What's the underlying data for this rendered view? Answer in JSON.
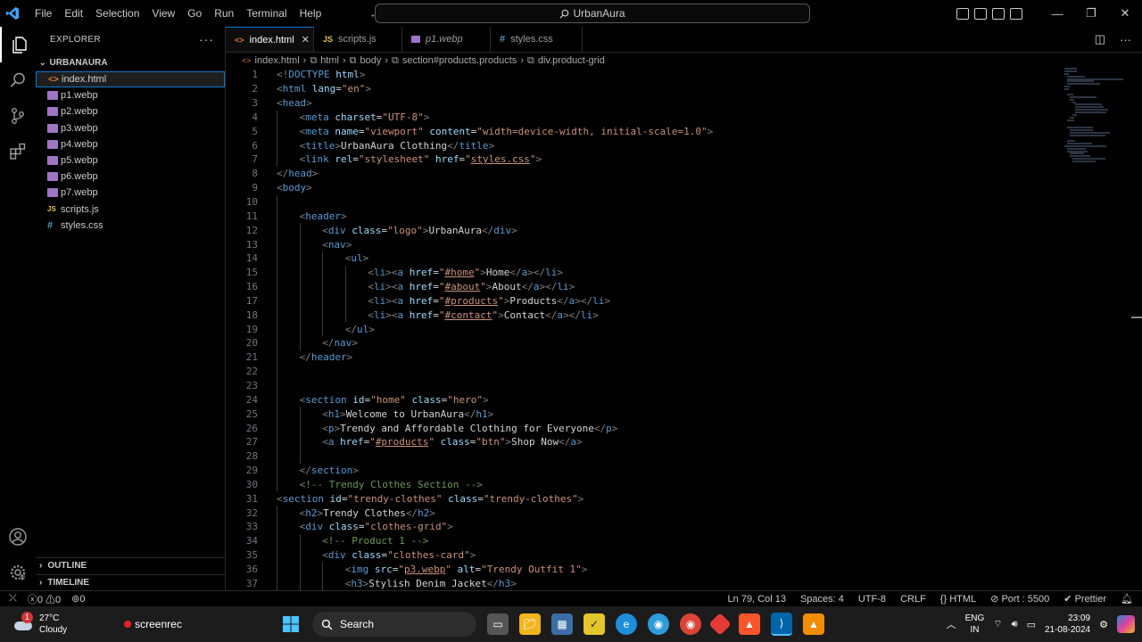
{
  "menu": [
    "File",
    "Edit",
    "Selection",
    "View",
    "Go",
    "Run",
    "Terminal",
    "Help"
  ],
  "command_center": "UrbanAura",
  "explorer": {
    "title": "EXPLORER",
    "folder": "URBANAURA",
    "files": [
      "index.html",
      "p1.webp",
      "p2.webp",
      "p3.webp",
      "p4.webp",
      "p5.webp",
      "p6.webp",
      "p7.webp",
      "scripts.js",
      "styles.css"
    ],
    "outline": "OUTLINE",
    "timeline": "TIMELINE"
  },
  "tabs": [
    "index.html",
    "scripts.js",
    "p1.webp",
    "styles.css"
  ],
  "breadcrumb": [
    "index.html",
    "html",
    "body",
    "section#products.products",
    "div.product-grid"
  ],
  "code_lines": [
    {
      "n": "1",
      "i": 0,
      "t": [
        [
          "tag",
          "<!"
        ],
        [
          "tn",
          "DOCTYPE"
        ],
        [
          "an",
          " html"
        ],
        [
          "tag",
          ">"
        ]
      ]
    },
    {
      "n": "2",
      "i": 0,
      "t": [
        [
          "tag",
          "<"
        ],
        [
          "tn",
          "html"
        ],
        [
          "an",
          " lang"
        ],
        [
          "tx",
          "="
        ],
        [
          "av",
          "\"en\""
        ],
        [
          "tag",
          ">"
        ]
      ]
    },
    {
      "n": "3",
      "i": 0,
      "t": [
        [
          "tag",
          "<"
        ],
        [
          "tn",
          "head"
        ],
        [
          "tag",
          ">"
        ]
      ]
    },
    {
      "n": "4",
      "i": 1,
      "t": [
        [
          "tag",
          "<"
        ],
        [
          "tn",
          "meta"
        ],
        [
          "an",
          " charset"
        ],
        [
          "tx",
          "="
        ],
        [
          "av",
          "\"UTF-8\""
        ],
        [
          "tag",
          ">"
        ]
      ]
    },
    {
      "n": "5",
      "i": 1,
      "t": [
        [
          "tag",
          "<"
        ],
        [
          "tn",
          "meta"
        ],
        [
          "an",
          " name"
        ],
        [
          "tx",
          "="
        ],
        [
          "av",
          "\"viewport\""
        ],
        [
          "an",
          " content"
        ],
        [
          "tx",
          "="
        ],
        [
          "av",
          "\"width=device-width, initial-scale=1.0\""
        ],
        [
          "tag",
          ">"
        ]
      ]
    },
    {
      "n": "6",
      "i": 1,
      "t": [
        [
          "tag",
          "<"
        ],
        [
          "tn",
          "title"
        ],
        [
          "tag",
          ">"
        ],
        [
          "tx",
          "UrbanAura Clothing"
        ],
        [
          "tag",
          "</"
        ],
        [
          "tn",
          "title"
        ],
        [
          "tag",
          ">"
        ]
      ]
    },
    {
      "n": "7",
      "i": 1,
      "t": [
        [
          "tag",
          "<"
        ],
        [
          "tn",
          "link"
        ],
        [
          "an",
          " rel"
        ],
        [
          "tx",
          "="
        ],
        [
          "av",
          "\"stylesheet\""
        ],
        [
          "an",
          " href"
        ],
        [
          "tx",
          "="
        ],
        [
          "av",
          "\""
        ],
        [
          "avu",
          "styles.css"
        ],
        [
          "av",
          "\""
        ],
        [
          "tag",
          ">"
        ]
      ]
    },
    {
      "n": "8",
      "i": 0,
      "t": [
        [
          "tag",
          "</"
        ],
        [
          "tn",
          "head"
        ],
        [
          "tag",
          ">"
        ]
      ]
    },
    {
      "n": "9",
      "i": 0,
      "t": [
        [
          "tag",
          "<"
        ],
        [
          "tn",
          "body"
        ],
        [
          "tag",
          ">"
        ]
      ]
    },
    {
      "n": "10",
      "i": 1,
      "t": []
    },
    {
      "n": "11",
      "i": 1,
      "t": [
        [
          "tag",
          "<"
        ],
        [
          "tn",
          "header"
        ],
        [
          "tag",
          ">"
        ]
      ]
    },
    {
      "n": "12",
      "i": 2,
      "t": [
        [
          "tag",
          "<"
        ],
        [
          "tn",
          "div"
        ],
        [
          "an",
          " class"
        ],
        [
          "tx",
          "="
        ],
        [
          "av",
          "\"logo\""
        ],
        [
          "tag",
          ">"
        ],
        [
          "tx",
          "UrbanAura"
        ],
        [
          "tag",
          "</"
        ],
        [
          "tn",
          "div"
        ],
        [
          "tag",
          ">"
        ]
      ]
    },
    {
      "n": "13",
      "i": 2,
      "t": [
        [
          "tag",
          "<"
        ],
        [
          "tn",
          "nav"
        ],
        [
          "tag",
          ">"
        ]
      ]
    },
    {
      "n": "14",
      "i": 3,
      "t": [
        [
          "tag",
          "<"
        ],
        [
          "tn",
          "ul"
        ],
        [
          "tag",
          ">"
        ]
      ]
    },
    {
      "n": "15",
      "i": 4,
      "t": [
        [
          "tag",
          "<"
        ],
        [
          "tn",
          "li"
        ],
        [
          "tag",
          "><"
        ],
        [
          "tn",
          "a"
        ],
        [
          "an",
          " href"
        ],
        [
          "tx",
          "="
        ],
        [
          "av",
          "\""
        ],
        [
          "avu",
          "#home"
        ],
        [
          "av",
          "\""
        ],
        [
          "tag",
          ">"
        ],
        [
          "tx",
          "Home"
        ],
        [
          "tag",
          "</"
        ],
        [
          "tn",
          "a"
        ],
        [
          "tag",
          "></"
        ],
        [
          "tn",
          "li"
        ],
        [
          "tag",
          ">"
        ]
      ]
    },
    {
      "n": "16",
      "i": 4,
      "t": [
        [
          "tag",
          "<"
        ],
        [
          "tn",
          "li"
        ],
        [
          "tag",
          "><"
        ],
        [
          "tn",
          "a"
        ],
        [
          "an",
          " href"
        ],
        [
          "tx",
          "="
        ],
        [
          "av",
          "\""
        ],
        [
          "avu",
          "#about"
        ],
        [
          "av",
          "\""
        ],
        [
          "tag",
          ">"
        ],
        [
          "tx",
          "About"
        ],
        [
          "tag",
          "</"
        ],
        [
          "tn",
          "a"
        ],
        [
          "tag",
          "></"
        ],
        [
          "tn",
          "li"
        ],
        [
          "tag",
          ">"
        ]
      ]
    },
    {
      "n": "17",
      "i": 4,
      "t": [
        [
          "tag",
          "<"
        ],
        [
          "tn",
          "li"
        ],
        [
          "tag",
          "><"
        ],
        [
          "tn",
          "a"
        ],
        [
          "an",
          " href"
        ],
        [
          "tx",
          "="
        ],
        [
          "av",
          "\""
        ],
        [
          "avu",
          "#products"
        ],
        [
          "av",
          "\""
        ],
        [
          "tag",
          ">"
        ],
        [
          "tx",
          "Products"
        ],
        [
          "tag",
          "</"
        ],
        [
          "tn",
          "a"
        ],
        [
          "tag",
          "></"
        ],
        [
          "tn",
          "li"
        ],
        [
          "tag",
          ">"
        ]
      ]
    },
    {
      "n": "18",
      "i": 4,
      "t": [
        [
          "tag",
          "<"
        ],
        [
          "tn",
          "li"
        ],
        [
          "tag",
          "><"
        ],
        [
          "tn",
          "a"
        ],
        [
          "an",
          " href"
        ],
        [
          "tx",
          "="
        ],
        [
          "av",
          "\""
        ],
        [
          "avu",
          "#contact"
        ],
        [
          "av",
          "\""
        ],
        [
          "tag",
          ">"
        ],
        [
          "tx",
          "Contact"
        ],
        [
          "tag",
          "</"
        ],
        [
          "tn",
          "a"
        ],
        [
          "tag",
          "></"
        ],
        [
          "tn",
          "li"
        ],
        [
          "tag",
          ">"
        ]
      ]
    },
    {
      "n": "19",
      "i": 3,
      "t": [
        [
          "tag",
          "</"
        ],
        [
          "tn",
          "ul"
        ],
        [
          "tag",
          ">"
        ]
      ]
    },
    {
      "n": "20",
      "i": 2,
      "t": [
        [
          "tag",
          "</"
        ],
        [
          "tn",
          "nav"
        ],
        [
          "tag",
          ">"
        ]
      ]
    },
    {
      "n": "21",
      "i": 1,
      "t": [
        [
          "tag",
          "</"
        ],
        [
          "tn",
          "header"
        ],
        [
          "tag",
          ">"
        ]
      ]
    },
    {
      "n": "22",
      "i": 1,
      "t": []
    },
    {
      "n": "23",
      "i": 1,
      "t": []
    },
    {
      "n": "24",
      "i": 1,
      "t": [
        [
          "tag",
          "<"
        ],
        [
          "tn",
          "section"
        ],
        [
          "an",
          " id"
        ],
        [
          "tx",
          "="
        ],
        [
          "av",
          "\"home\""
        ],
        [
          "an",
          " class"
        ],
        [
          "tx",
          "="
        ],
        [
          "av",
          "\"hero\""
        ],
        [
          "tag",
          ">"
        ]
      ]
    },
    {
      "n": "25",
      "i": 2,
      "t": [
        [
          "tag",
          "<"
        ],
        [
          "tn",
          "h1"
        ],
        [
          "tag",
          ">"
        ],
        [
          "tx",
          "Welcome to UrbanAura"
        ],
        [
          "tag",
          "</"
        ],
        [
          "tn",
          "h1"
        ],
        [
          "tag",
          ">"
        ]
      ]
    },
    {
      "n": "26",
      "i": 2,
      "t": [
        [
          "tag",
          "<"
        ],
        [
          "tn",
          "p"
        ],
        [
          "tag",
          ">"
        ],
        [
          "tx",
          "Trendy and Affordable Clothing for Everyone"
        ],
        [
          "tag",
          "</"
        ],
        [
          "tn",
          "p"
        ],
        [
          "tag",
          ">"
        ]
      ]
    },
    {
      "n": "27",
      "i": 2,
      "t": [
        [
          "tag",
          "<"
        ],
        [
          "tn",
          "a"
        ],
        [
          "an",
          " href"
        ],
        [
          "tx",
          "="
        ],
        [
          "av",
          "\""
        ],
        [
          "avu",
          "#products"
        ],
        [
          "av",
          "\""
        ],
        [
          "an",
          " class"
        ],
        [
          "tx",
          "="
        ],
        [
          "av",
          "\"btn\""
        ],
        [
          "tag",
          ">"
        ],
        [
          "tx",
          "Shop Now"
        ],
        [
          "tag",
          "</"
        ],
        [
          "tn",
          "a"
        ],
        [
          "tag",
          ">"
        ]
      ]
    },
    {
      "n": "28",
      "i": 2,
      "t": []
    },
    {
      "n": "29",
      "i": 1,
      "t": [
        [
          "tag",
          "</"
        ],
        [
          "tn",
          "section"
        ],
        [
          "tag",
          ">"
        ]
      ]
    },
    {
      "n": "30",
      "i": 1,
      "t": [
        [
          "cm",
          "<!-- Trendy Clothes Section -->"
        ]
      ]
    },
    {
      "n": "31",
      "i": 0,
      "t": [
        [
          "tag",
          "<"
        ],
        [
          "tn",
          "section"
        ],
        [
          "an",
          " id"
        ],
        [
          "tx",
          "="
        ],
        [
          "av",
          "\"trendy-clothes\""
        ],
        [
          "an",
          " class"
        ],
        [
          "tx",
          "="
        ],
        [
          "av",
          "\"trendy-clothes\""
        ],
        [
          "tag",
          ">"
        ]
      ]
    },
    {
      "n": "32",
      "i": 1,
      "t": [
        [
          "tag",
          "<"
        ],
        [
          "tn",
          "h2"
        ],
        [
          "tag",
          ">"
        ],
        [
          "tx",
          "Trendy Clothes"
        ],
        [
          "tag",
          "</"
        ],
        [
          "tn",
          "h2"
        ],
        [
          "tag",
          ">"
        ]
      ]
    },
    {
      "n": "33",
      "i": 1,
      "t": [
        [
          "tag",
          "<"
        ],
        [
          "tn",
          "div"
        ],
        [
          "an",
          " class"
        ],
        [
          "tx",
          "="
        ],
        [
          "av",
          "\"clothes-grid\""
        ],
        [
          "tag",
          ">"
        ]
      ]
    },
    {
      "n": "34",
      "i": 2,
      "t": [
        [
          "cm",
          "<!-- Product 1 -->"
        ]
      ]
    },
    {
      "n": "35",
      "i": 2,
      "t": [
        [
          "tag",
          "<"
        ],
        [
          "tn",
          "div"
        ],
        [
          "an",
          " class"
        ],
        [
          "tx",
          "="
        ],
        [
          "av",
          "\"clothes-card\""
        ],
        [
          "tag",
          ">"
        ]
      ]
    },
    {
      "n": "36",
      "i": 3,
      "t": [
        [
          "tag",
          "<"
        ],
        [
          "tn",
          "img"
        ],
        [
          "an",
          " src"
        ],
        [
          "tx",
          "="
        ],
        [
          "av",
          "\""
        ],
        [
          "avu",
          "p3.webp"
        ],
        [
          "av",
          "\""
        ],
        [
          "an",
          " alt"
        ],
        [
          "tx",
          "="
        ],
        [
          "av",
          "\"Trendy Outfit 1\""
        ],
        [
          "tag",
          ">"
        ]
      ]
    },
    {
      "n": "37",
      "i": 3,
      "t": [
        [
          "tag",
          "<"
        ],
        [
          "tn",
          "h3"
        ],
        [
          "tag",
          ">"
        ],
        [
          "tx",
          "Stylish Denim Jacket"
        ],
        [
          "tag",
          "</"
        ],
        [
          "tn",
          "h3"
        ],
        [
          "tag",
          ">"
        ]
      ]
    }
  ],
  "status": {
    "errors": "0",
    "warnings": "0",
    "ports": "0",
    "position": "Ln 79, Col 13",
    "spaces": "Spaces: 4",
    "encoding": "UTF-8",
    "eol": "CRLF",
    "language": "HTML",
    "port": "Port : 5500",
    "prettier": "Prettier"
  },
  "taskbar": {
    "temp": "27°C",
    "weather": "Cloudy",
    "badge": "1",
    "screenrec": "screenrec",
    "search": "Search",
    "lang1": "ENG",
    "lang2": "IN",
    "time": "23:09",
    "date": "21-08-2024"
  },
  "colors": {
    "accent": "#0078d4",
    "tag_name": "#569cd6",
    "attr_name": "#9cdcfe",
    "attr_value": "#ce9178",
    "comment": "#6a9955"
  }
}
